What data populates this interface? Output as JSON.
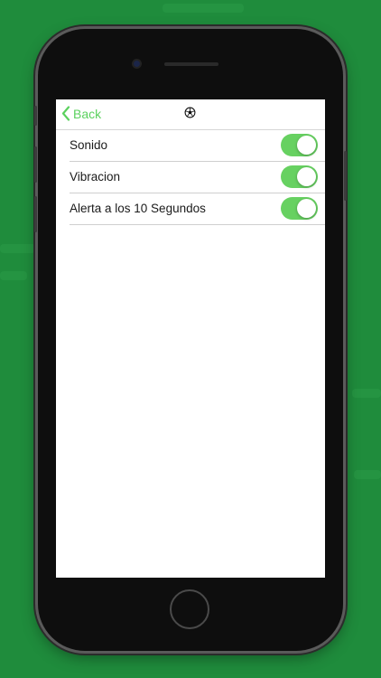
{
  "nav": {
    "back_label": "Back",
    "back_icon": "chevron-left-icon",
    "title_icon": "soccer-ball-icon"
  },
  "settings": {
    "items": [
      {
        "label": "Sonido",
        "enabled": true
      },
      {
        "label": "Vibracion",
        "enabled": true
      },
      {
        "label": "Alerta a los 10 Segundos",
        "enabled": true
      }
    ]
  },
  "colors": {
    "background": "#1f8c3c",
    "accent": "#5bd15e",
    "toggle_on": "#67d161"
  }
}
